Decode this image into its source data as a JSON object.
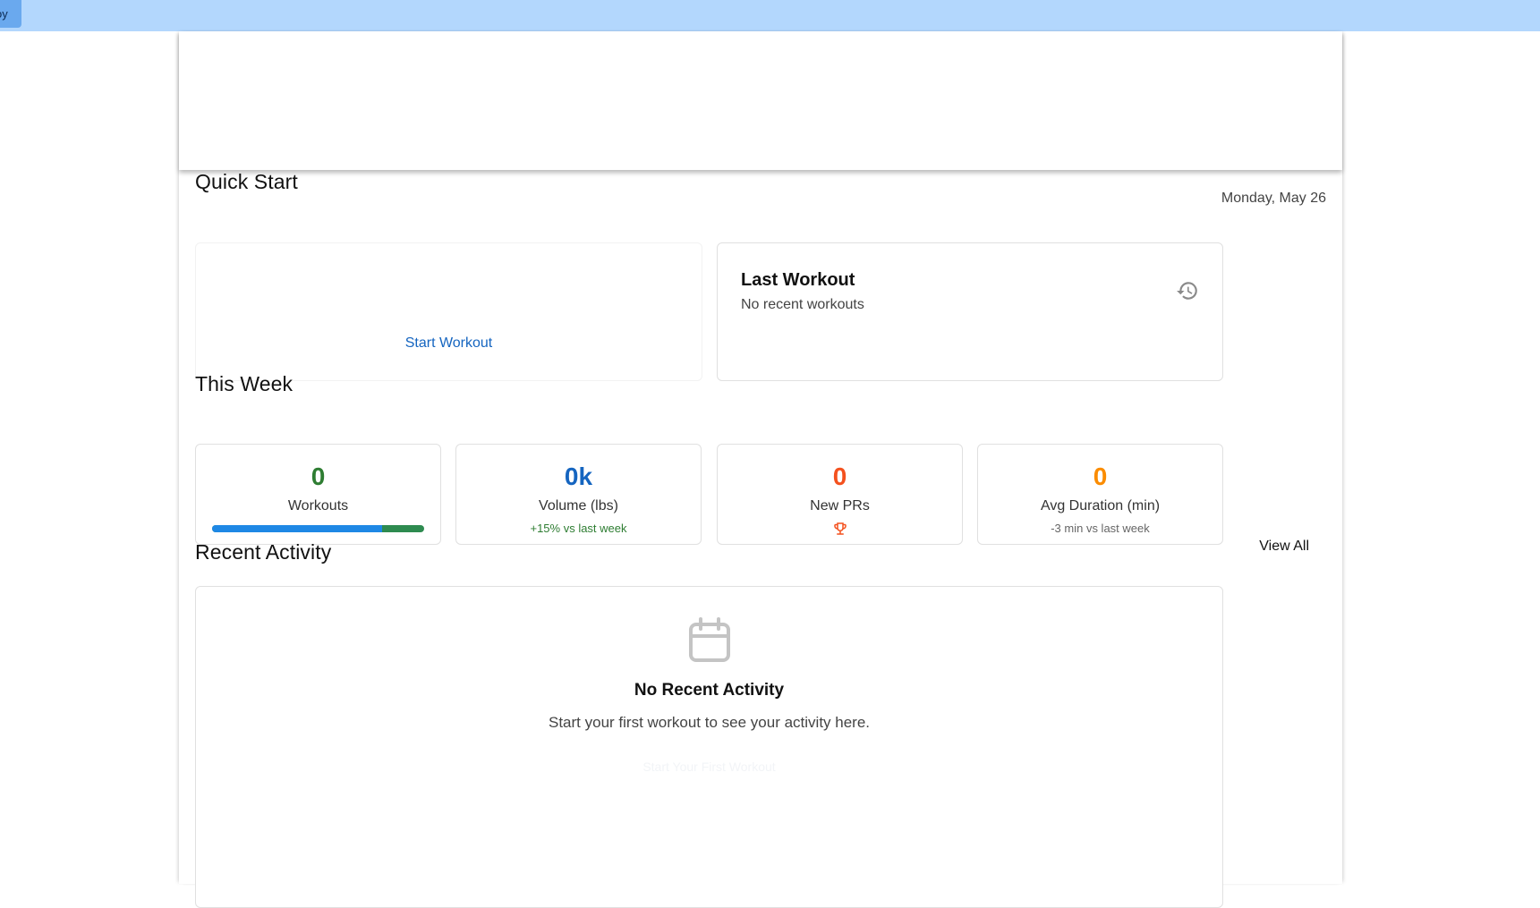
{
  "topbar": {
    "chip_label": "oy",
    "color": "#b3d7fd"
  },
  "quick_start": {
    "title": "Quick Start",
    "date": "Monday, May 26",
    "start_workout_label": "Start Workout",
    "last_workout": {
      "title": "Last Workout",
      "subtitle": "No recent workouts",
      "icon": "history-icon"
    }
  },
  "this_week": {
    "title": "This Week",
    "stats": [
      {
        "value": "0",
        "label": "Workouts",
        "color": "#2e7d32",
        "progress": 0.8
      },
      {
        "value": "0k",
        "label": "Volume (lbs)",
        "color": "#1565c0",
        "sub": "+15% vs last week",
        "sub_color": "#2e7d32"
      },
      {
        "value": "0",
        "label": "New PRs",
        "color": "#f4511e",
        "icon": "trophy-icon"
      },
      {
        "value": "0",
        "label": "Avg Duration (min)",
        "color": "#fb8c00",
        "sub": "-3 min vs last week",
        "sub_color": "#666666"
      }
    ]
  },
  "recent_activity": {
    "title": "Recent Activity",
    "view_all_label": "View All",
    "empty": {
      "icon": "calendar-icon",
      "title": "No Recent Activity",
      "text": "Start your first workout to see your activity here.",
      "button_label": "Start Your First Workout"
    }
  }
}
